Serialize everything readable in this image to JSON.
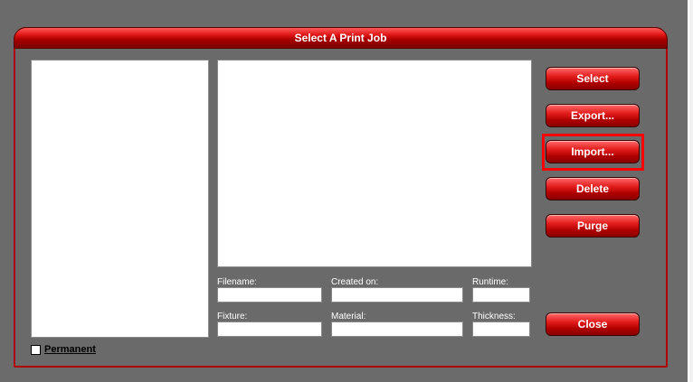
{
  "dialog": {
    "title": "Select A Print Job"
  },
  "fields": {
    "filename_label": "Filename:",
    "created_on_label": "Created on:",
    "runtime_label": "Runtime:",
    "fixture_label": "Fixture:",
    "material_label": "Material:",
    "thickness_label": "Thickness:"
  },
  "buttons": {
    "select": "Select",
    "export": "Export...",
    "import": "Import...",
    "delete": "Delete",
    "purge": "Purge",
    "close": "Close"
  },
  "permanent": {
    "label": "Permanent",
    "checked": false
  },
  "colors": {
    "accent": "#d40000",
    "highlight": "#ff0000"
  }
}
